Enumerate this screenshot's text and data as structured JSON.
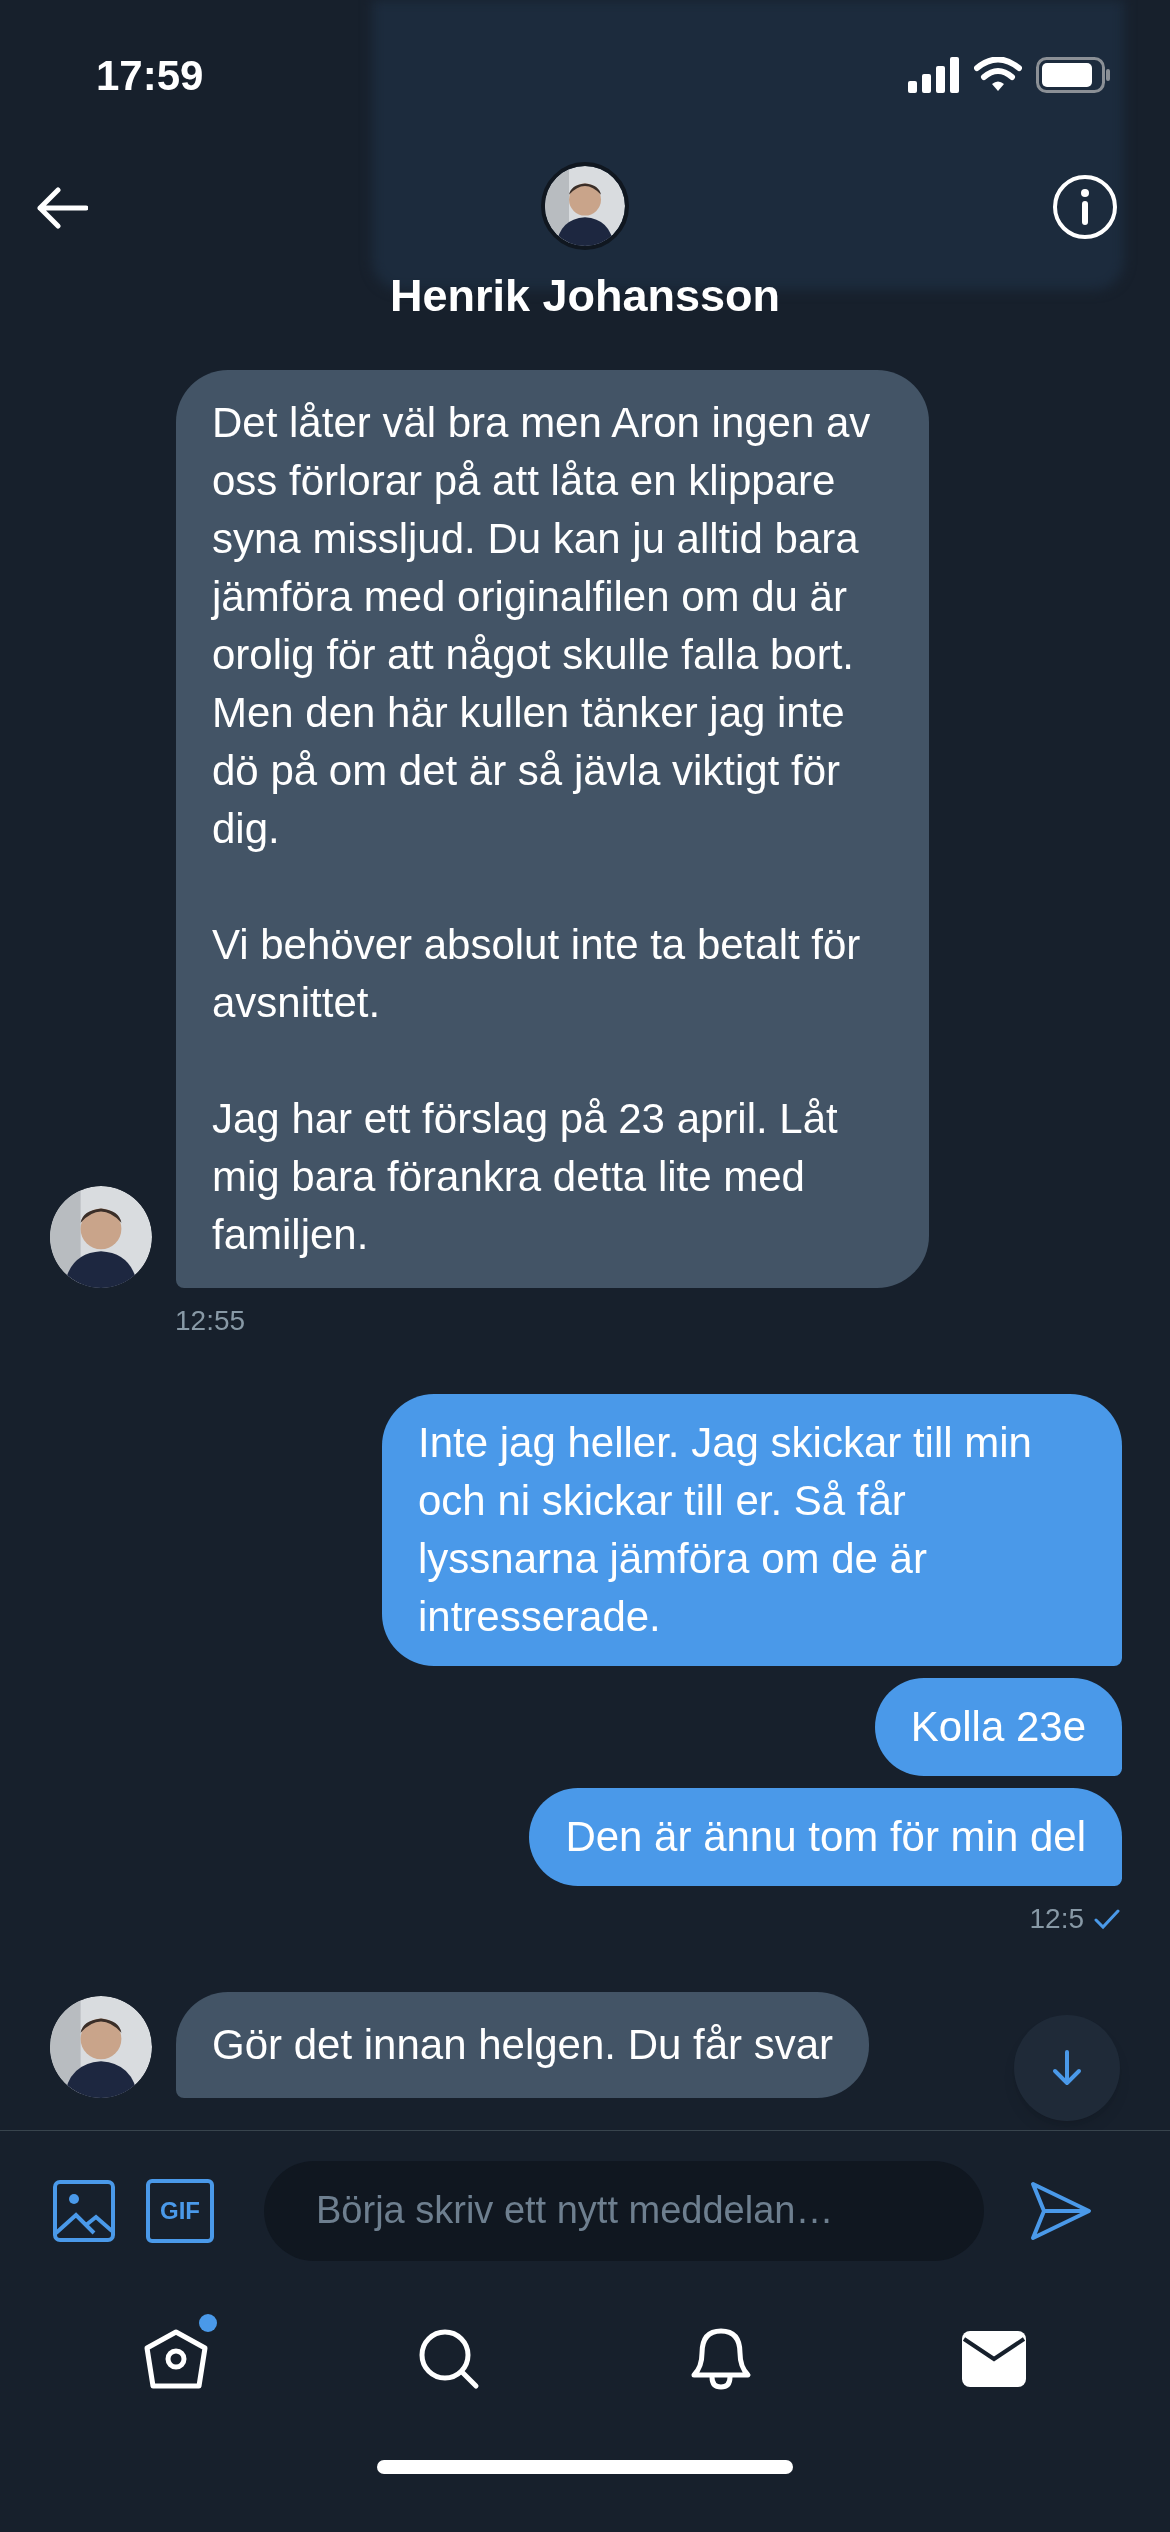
{
  "status_bar": {
    "time": "17:59"
  },
  "header": {
    "name": "Henrik Johansson"
  },
  "messages": [
    {
      "kind": "received",
      "paragraphs": [
        "Det låter väl bra men Aron ingen av oss förlorar på att låta en klippare syna missljud. Du kan ju alltid bara jämföra med originalfilen om du är orolig för att något skulle falla bort. Men den här kullen tänker jag inte dö på om det är så jävla viktigt för dig.",
        "Vi behöver absolut inte ta betalt för avsnittet.",
        "Jag har ett förslag på 23 april. Låt mig bara förankra detta lite med familjen."
      ]
    },
    {
      "kind": "time_received",
      "text": "12:55"
    },
    {
      "kind": "sent",
      "paragraphs": [
        "Inte jag heller. Jag skickar till min och ni skickar till er. Så får lyssnarna jämföra om de är intresserade."
      ]
    },
    {
      "kind": "sent",
      "paragraphs": [
        "Kolla 23e"
      ]
    },
    {
      "kind": "sent",
      "paragraphs": [
        "Den är ännu tom för min del"
      ]
    },
    {
      "kind": "time_sent",
      "text": "12:5",
      "read": true
    },
    {
      "kind": "received",
      "paragraphs": [
        "Gör det innan helgen. Du får svar"
      ]
    }
  ],
  "composer": {
    "placeholder": "Börja skriv ett nytt meddelan…",
    "gif_label": "GIF"
  },
  "tab_bar": {
    "home_badge": true
  }
}
